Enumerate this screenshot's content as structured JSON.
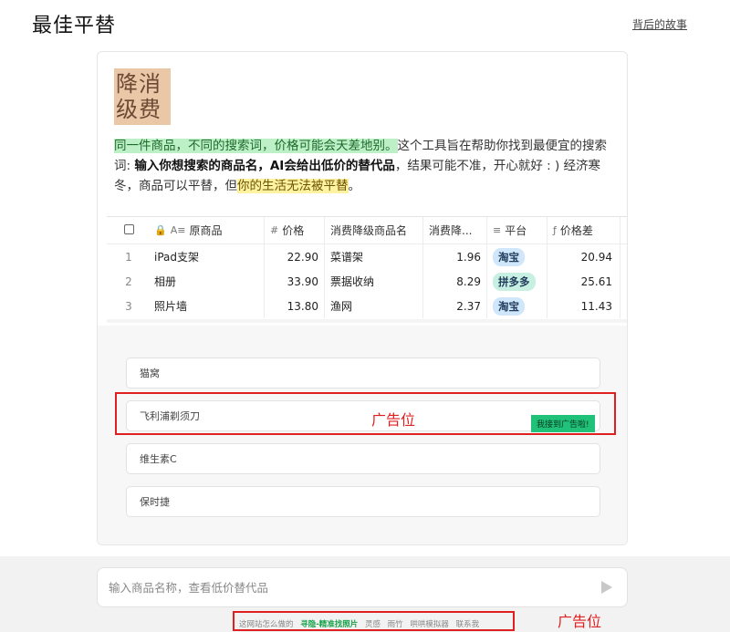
{
  "header": {
    "title": "最佳平替",
    "story_link": "背后的故事"
  },
  "logo": {
    "line1": "降消",
    "line2": "级费"
  },
  "intro": {
    "p1": "同一件商品，不同的搜索词，价格可能会天差地别。",
    "p2": "这个工具旨在帮助你找到最便宜的搜索词: ",
    "p3": "输入你想搜索的商品名，AI会给出低价的替代品",
    "p4": "，结果可能不准，开心就好 : ) 经济寒冬，商品可以平替，但",
    "p5": "你的生活无法被平替",
    "p6": "。"
  },
  "table": {
    "headers": {
      "name": "原商品",
      "price": "价格",
      "alt": "消费降级商品名",
      "down": "消费降...",
      "platform": "平台",
      "diff": "价格差"
    },
    "rows": [
      {
        "idx": "1",
        "name": "iPad支架",
        "price": "22.90",
        "alt": "菜谱架",
        "down": "1.96",
        "platform": "淘宝",
        "diff": "20.94"
      },
      {
        "idx": "2",
        "name": "相册",
        "price": "33.90",
        "alt": "票据收纳",
        "down": "8.29",
        "platform": "拼多多",
        "diff": "25.61"
      },
      {
        "idx": "3",
        "name": "照片墙",
        "price": "13.80",
        "alt": "渔网",
        "down": "2.37",
        "platform": "淘宝",
        "diff": "11.43"
      }
    ]
  },
  "suggestions": [
    "猫窝",
    "飞利浦剃须刀",
    "维生素C",
    "保时捷"
  ],
  "ad": {
    "label": "广告位",
    "badge": "我接到广告啦!"
  },
  "search": {
    "placeholder": "输入商品名称，查看低价替代品"
  },
  "footer": {
    "how": "这网站怎么做的",
    "find_photo": "寻隐-精准找照片",
    "inspiration": "灵感",
    "rain": "雨竹",
    "simulator": "哄哄模拟器",
    "contact": "联系我",
    "ad_label": "广告位"
  },
  "colors": {
    "ad_red": "#e02020",
    "logo_bg": "#eac7a6",
    "highlight_green": "#bdf0c7",
    "highlight_yellow": "#fff2a0"
  }
}
